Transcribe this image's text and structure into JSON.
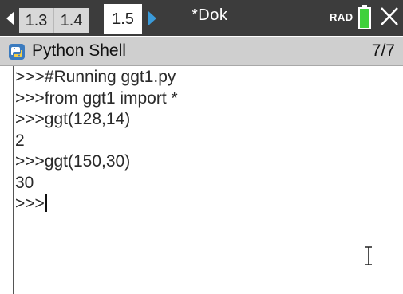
{
  "tabs": [
    {
      "label": "1.3"
    },
    {
      "label": "1.4"
    },
    {
      "label": "1.5"
    }
  ],
  "active_tab": "1.5",
  "document_title": "*Dok",
  "angle_mode": "RAD",
  "battery_color": "#3fd13b",
  "app": {
    "title": "Python Shell",
    "page_count": "7/7"
  },
  "shell": {
    "lines": [
      ">>>#Running ggt1.py",
      ">>>from ggt1 import *",
      ">>>ggt(128,14)",
      "2",
      ">>>ggt(150,30)",
      "30",
      ">>>"
    ]
  },
  "icons": [
    "arrow-left-icon",
    "arrow-right-icon",
    "battery-icon",
    "close-icon",
    "python-icon",
    "text-cursor-icon"
  ]
}
